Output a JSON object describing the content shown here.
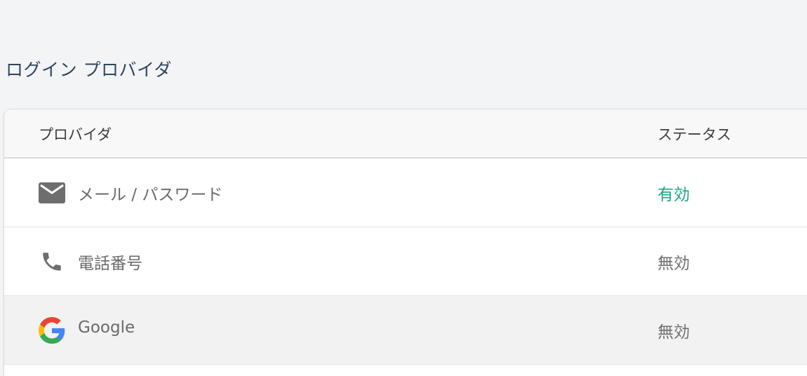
{
  "section": {
    "title": "ログイン プロバイダ"
  },
  "table": {
    "columns": {
      "provider": "プロバイダ",
      "status": "ステータス"
    },
    "rows": [
      {
        "name": "メール / パスワード",
        "status": "有効",
        "icon": "email-icon",
        "enabled": true
      },
      {
        "name": "電話番号",
        "status": "無効",
        "icon": "phone-icon",
        "enabled": false
      },
      {
        "name": "Google",
        "status": "無効",
        "icon": "google-icon",
        "enabled": false
      }
    ]
  },
  "colors": {
    "enabled_status": "#1aa58a",
    "disabled_status": "#707070",
    "title": "#2f4660"
  }
}
